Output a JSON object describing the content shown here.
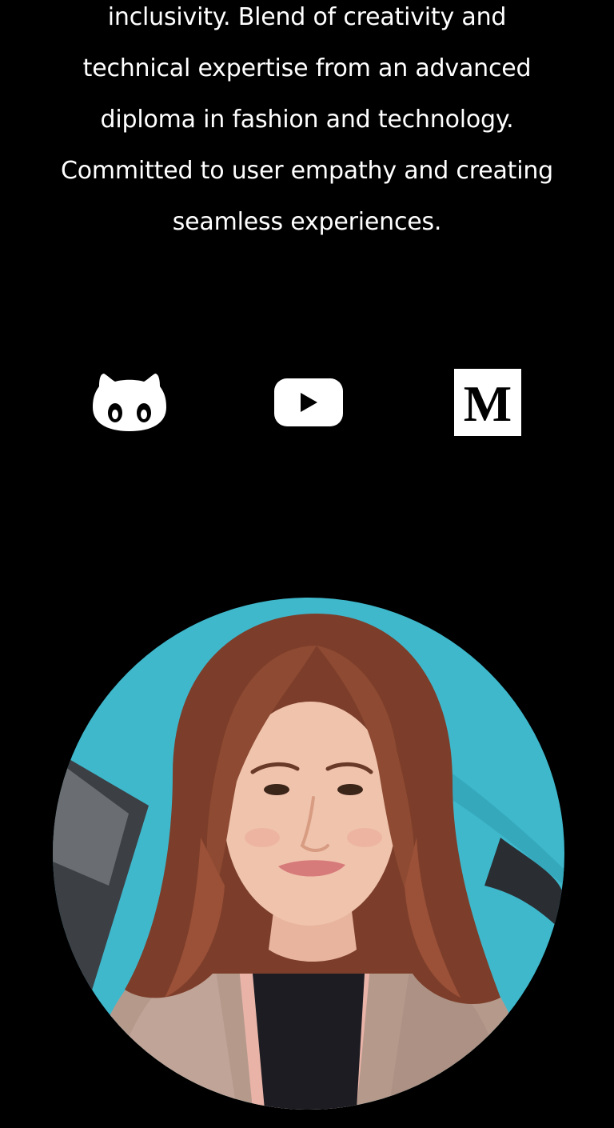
{
  "bio": {
    "lines": [
      "inclusivity. Blend of creativity and",
      "technical expertise from an advanced",
      "diploma in fashion and technology.",
      "Committed to user empathy and creating",
      "seamless experiences."
    ]
  },
  "socials": [
    {
      "name": "GitHub",
      "icon": "github-octocat-icon"
    },
    {
      "name": "YouTube",
      "icon": "youtube-play-icon"
    },
    {
      "name": "Medium",
      "icon": "medium-icon",
      "letter": "M"
    }
  ],
  "profile_photo": {
    "subject": "profile-photo"
  },
  "colors": {
    "background": "#000000",
    "text": "#ffffff",
    "photo_backdrop": "#3fb8cc",
    "hair": "#8a4630"
  }
}
